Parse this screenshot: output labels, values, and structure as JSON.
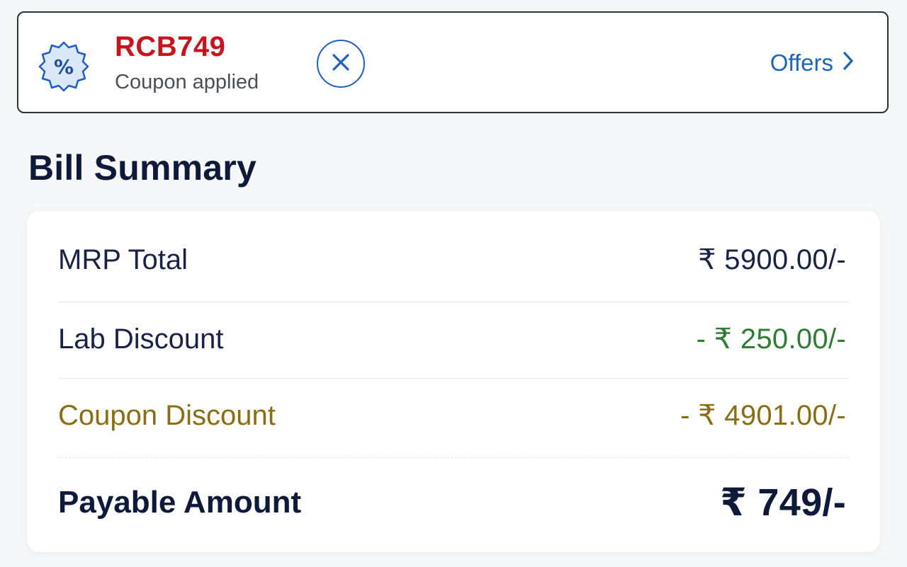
{
  "coupon": {
    "code": "RCB749",
    "status": "Coupon applied",
    "badge_icon": "percent-badge-icon",
    "remove_icon": "close-icon",
    "offers_label": "Offers",
    "offers_icon": "chevron-right-icon"
  },
  "bill": {
    "title": "Bill Summary",
    "rows": [
      {
        "label": "MRP Total",
        "value": "₹ 5900.00/-"
      },
      {
        "label": "Lab Discount",
        "value": "- ₹ 250.00/-"
      },
      {
        "label": "Coupon Discount",
        "value": "- ₹ 4901.00/-"
      },
      {
        "label": "Payable Amount",
        "value": "₹ 749/-"
      }
    ]
  },
  "colors": {
    "coupon_code": "#c4161c",
    "link_blue": "#1f64b8",
    "discount_green": "#2e7d32",
    "coupon_gold": "#8a6d14",
    "heading_navy": "#0f1a3a"
  }
}
